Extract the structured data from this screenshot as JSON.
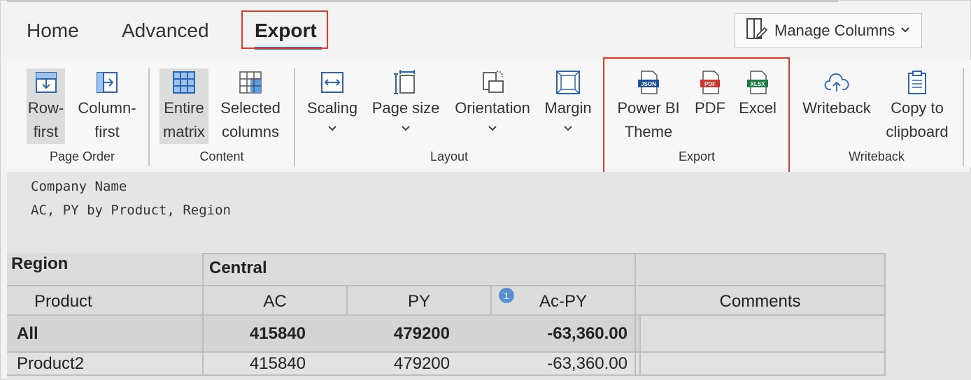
{
  "tabs": {
    "home": "Home",
    "advanced": "Advanced",
    "export": "Export"
  },
  "manage_columns": {
    "label": "Manage Columns",
    "chevron": "⌄"
  },
  "ribbon": {
    "page_order": {
      "row_first": [
        "Row-",
        "first"
      ],
      "column_first": [
        "Column-",
        "first"
      ],
      "group": "Page Order"
    },
    "content": {
      "entire_matrix": [
        "Entire",
        "matrix"
      ],
      "selected_columns": [
        "Selected",
        "columns"
      ],
      "group": "Content"
    },
    "layout": {
      "scaling": "Scaling",
      "page_size": "Page size",
      "orientation": "Orientation",
      "margin": "Margin",
      "group": "Layout",
      "chevron": "⌄"
    },
    "export": {
      "powerbi_theme": [
        "Power BI",
        "Theme"
      ],
      "pdf": "PDF",
      "excel": "Excel",
      "group": "Export",
      "json_tag": "JSON",
      "pdf_tag": "PDF",
      "xlsx_tag": "XLSX"
    },
    "writeback": {
      "writeback": "Writeback",
      "copy_clipboard": [
        "Copy to",
        "clipboard"
      ],
      "group": "Writeback"
    }
  },
  "report": {
    "company": "Company Name",
    "subtitle": "AC, PY by Product, Region",
    "table": {
      "region_label": "Region",
      "region_value": "Central",
      "product_label": "Product",
      "columns": [
        "AC",
        "PY",
        "Ac-PY",
        "Comments"
      ],
      "badge": "1",
      "rows": [
        {
          "product": "All",
          "ac": "415840",
          "py": "479200",
          "diff": "-63,360.00",
          "comments": ""
        },
        {
          "product": "Product2",
          "ac": "415840",
          "py": "479200",
          "diff": "-63,360.00",
          "comments": ""
        }
      ]
    }
  },
  "colors": {
    "accent": "#1a73c7",
    "highlight": "#e03a2a",
    "badge": "#5a8fd0"
  }
}
